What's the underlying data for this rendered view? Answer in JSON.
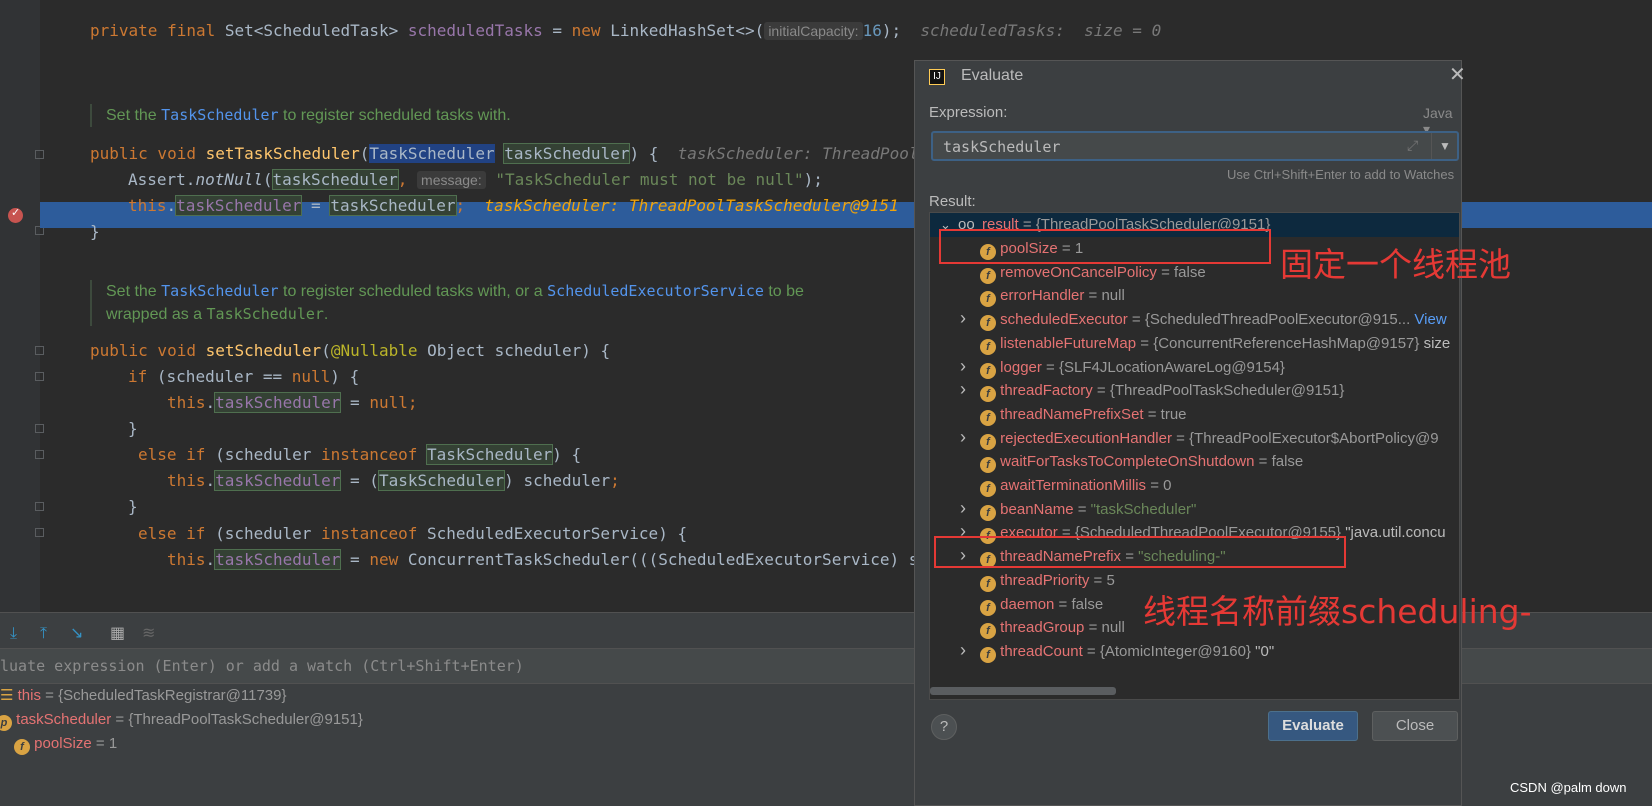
{
  "editor": {
    "line1": {
      "kw": "private final ",
      "type": "Set<ScheduledTask> ",
      "field": "scheduledTasks",
      "eq": " = ",
      "new": "new ",
      "ctor": "LinkedHashSet<>(",
      "param_hint": "initialCapacity:",
      "num": "16",
      "end": ");",
      "inline_hint": "scheduledTasks:  size = 0"
    },
    "doc1": {
      "pre": "Set the ",
      "ref": "TaskScheduler",
      "post": " to register scheduled tasks with."
    },
    "line2": {
      "kw": "public void ",
      "method": "setTaskScheduler",
      "open": "(",
      "ptype": "TaskScheduler",
      "pname": "taskScheduler",
      "rest": ") {  ",
      "inline_hint": "taskScheduler: ThreadPoolTaskScheduler@9151"
    },
    "line3": {
      "obj": "Assert.",
      "method": "notNull",
      "open": "(",
      "arg": "taskScheduler",
      "comma": ",",
      "param_hint": "message:",
      "str": "\"TaskScheduler must not be null\"",
      "end": ");"
    },
    "line4": {
      "this": "this",
      "dot": ".",
      "field": "taskScheduler",
      "eq": " = ",
      "val": "taskScheduler",
      "semi": ";",
      "inline_hint": "taskScheduler: ThreadPoolTaskScheduler@9151"
    },
    "line5": "}",
    "doc2": {
      "pre": "Set the ",
      "ref1": "TaskScheduler",
      "mid": " to register scheduled tasks with, or a ",
      "ref2": "ScheduledExecutorService",
      "post": " to be",
      "line2pre": "wrapped as a ",
      "code": "TaskScheduler",
      "line2post": "."
    },
    "line6": {
      "kw": "public void ",
      "method": "setScheduler",
      "open": "(",
      "ann": "@Nullable",
      "rest": " Object scheduler) {"
    },
    "line7": {
      "kw": "if ",
      "a": "(scheduler == ",
      "nullkw": "null",
      "b": ") {"
    },
    "line8": {
      "this": "this",
      "dot": ".",
      "field": "taskScheduler",
      "eq": " = ",
      "nullkw": "null",
      "semi": ";"
    },
    "line9": "}",
    "line10": {
      "kw": "else if ",
      "a": "(scheduler ",
      "inst": "instanceof ",
      "type": "TaskScheduler",
      "b": ") {"
    },
    "line11": {
      "this": "this",
      "dot": ".",
      "field": "taskScheduler",
      "a": " = (",
      "type": "TaskScheduler",
      "b": ") scheduler",
      "semi": ";"
    },
    "line12": "}",
    "line13": {
      "kw": "else if ",
      "a": "(scheduler ",
      "inst": "instanceof ",
      "b": "ScheduledExecutorService) {"
    },
    "line14": {
      "this": "this",
      "dot": ".",
      "field": "taskScheduler",
      "eq": " = ",
      "new": "new ",
      "b": "ConcurrentTaskScheduler(((ScheduledExecutorService) sc"
    }
  },
  "watch": {
    "placeholder": "luate expression (Enter) or add a watch (Ctrl+Shift+Enter)"
  },
  "variables": [
    {
      "name": "this",
      "value": " = {ScheduledTaskRegistrar@11739}"
    },
    {
      "name": "taskScheduler",
      "value": " = {ThreadPoolTaskScheduler@9151}"
    },
    {
      "name": "poolSize",
      "value": " = 1"
    }
  ],
  "dialog": {
    "title": "Evaluate",
    "expression_label": "Expression:",
    "language": "Java ▾",
    "expression_value": "taskScheduler",
    "hint": "Use Ctrl+Shift+Enter to add to Watches",
    "result_label": "Result:",
    "result_root": {
      "name": "result",
      "value": " = {ThreadPoolTaskScheduler@9151}"
    },
    "fields": [
      {
        "name": "poolSize",
        "value": " = 1",
        "expand": false
      },
      {
        "name": "removeOnCancelPolicy",
        "value": " = false",
        "expand": false
      },
      {
        "name": "errorHandler",
        "value": " = null",
        "expand": false
      },
      {
        "name": "scheduledExecutor",
        "value": " = {ScheduledThreadPoolExecutor@915...",
        "link": " View",
        "expand": true
      },
      {
        "name": "listenableFutureMap",
        "value": " = {ConcurrentReferenceHashMap@9157} ",
        "extra": "size",
        "expand": false
      },
      {
        "name": "logger",
        "value": " = {SLF4JLocationAwareLog@9154}",
        "expand": true
      },
      {
        "name": "threadFactory",
        "value": " = {ThreadPoolTaskScheduler@9151}",
        "expand": true
      },
      {
        "name": "threadNamePrefixSet",
        "value": " = true",
        "expand": false
      },
      {
        "name": "rejectedExecutionHandler",
        "value": " = {ThreadPoolExecutor$AbortPolicy@9",
        "expand": true
      },
      {
        "name": "waitForTasksToCompleteOnShutdown",
        "value": " = false",
        "expand": false
      },
      {
        "name": "awaitTerminationMillis",
        "value": " = 0",
        "expand": false
      },
      {
        "name": "beanName",
        "value": " = ",
        "str": "\"taskScheduler\"",
        "expand": true
      },
      {
        "name": "executor",
        "value": " = {ScheduledThreadPoolExecutor@9155} ",
        "extra": "\"java.util.concu",
        "expand": true
      },
      {
        "name": "threadNamePrefix",
        "value": " = ",
        "str": "\"scheduling-\"",
        "expand": true
      },
      {
        "name": "threadPriority",
        "value": " = 5",
        "expand": false
      },
      {
        "name": "daemon",
        "value": " = false",
        "expand": false
      },
      {
        "name": "threadGroup",
        "value": " = null",
        "expand": false
      },
      {
        "name": "threadCount",
        "value": " = {AtomicInteger@9160} ",
        "extra": "\"0\"",
        "expand": true
      }
    ],
    "evaluate_button": "Evaluate",
    "close_button": "Close",
    "help_button": "?"
  },
  "annotations": {
    "note1": "固定一个线程池",
    "note2": "线程名称前缀scheduling-"
  },
  "watermark": "CSDN @palm down",
  "colors": {
    "accent": "#365880",
    "highlight_line": "#2d5c9b",
    "annotation_red": "#e53935"
  }
}
